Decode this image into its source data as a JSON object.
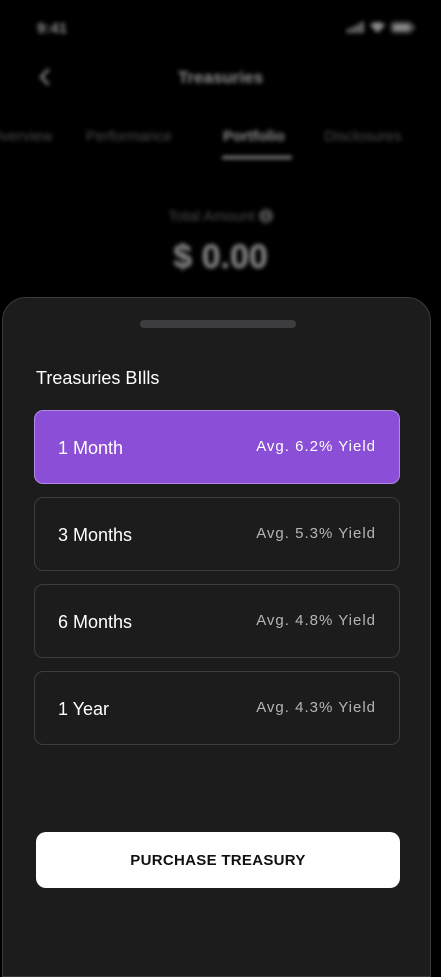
{
  "status_bar": {
    "time": "9:41",
    "icons": [
      "signal-icon",
      "wifi-icon",
      "battery-icon"
    ]
  },
  "header": {
    "back_icon": "chevron-left-icon",
    "title": "Treasuries"
  },
  "tabs": [
    {
      "label": "Overview",
      "active": false
    },
    {
      "label": "Performance",
      "active": false
    },
    {
      "label": "Portfolio",
      "active": true
    },
    {
      "label": "Disclosures",
      "active": false
    }
  ],
  "summary": {
    "total_label": "Total Amount",
    "info_icon": "info-icon",
    "total_value": "$ 0.00"
  },
  "sheet": {
    "title": "Treasuries BIlls",
    "options": [
      {
        "term": "1 Month",
        "yield": "Avg. 6.2% Yield",
        "selected": true
      },
      {
        "term": "3 Months",
        "yield": "Avg. 5.3% Yield",
        "selected": false
      },
      {
        "term": "6 Months",
        "yield": "Avg. 4.8% Yield",
        "selected": false
      },
      {
        "term": "1 Year",
        "yield": "Avg. 4.3% Yield",
        "selected": false
      }
    ],
    "purchase_label": "PURCHASE TREASURY"
  },
  "colors": {
    "accent": "#8a4fd6",
    "sheet_background": "#1c1c1d",
    "background": "#000000"
  }
}
